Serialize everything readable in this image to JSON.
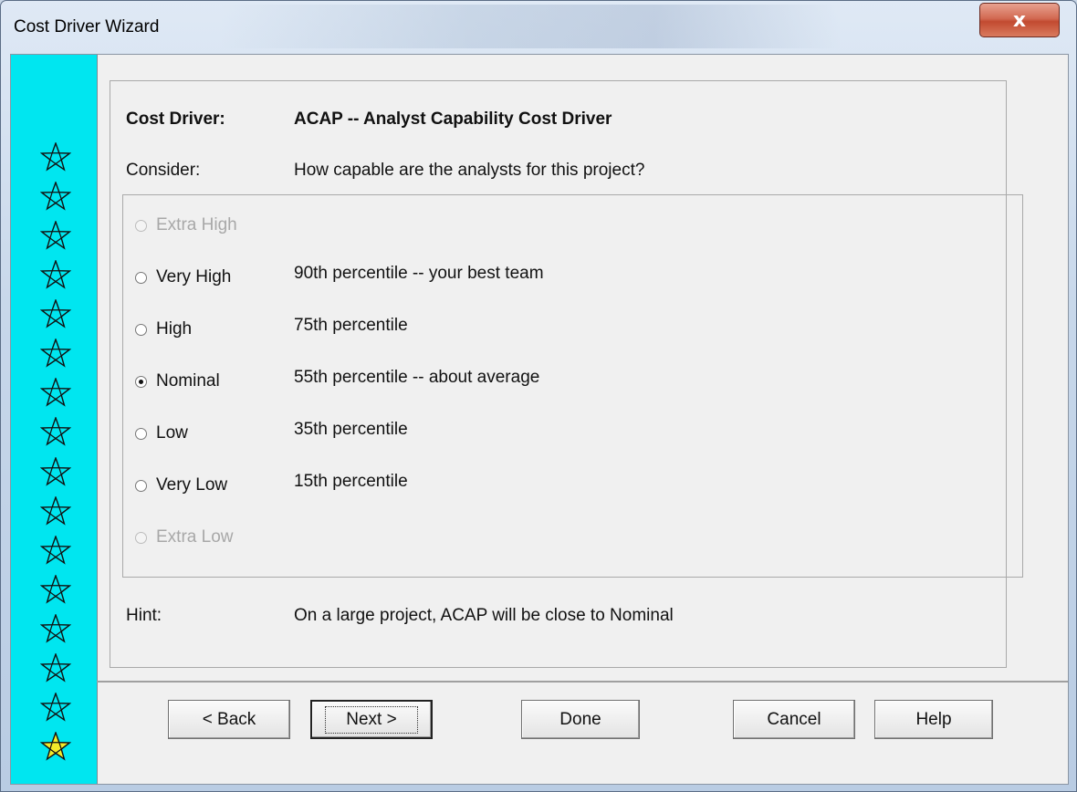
{
  "window": {
    "title": "Cost Driver Wizard",
    "close_glyph": "x"
  },
  "star_strip": {
    "stars": [
      {
        "state": "done"
      },
      {
        "state": "done"
      },
      {
        "state": "done"
      },
      {
        "state": "done"
      },
      {
        "state": "done"
      },
      {
        "state": "done"
      },
      {
        "state": "done"
      },
      {
        "state": "done"
      },
      {
        "state": "done"
      },
      {
        "state": "done"
      },
      {
        "state": "done"
      },
      {
        "state": "done"
      },
      {
        "state": "done"
      },
      {
        "state": "done"
      },
      {
        "state": "done"
      },
      {
        "state": "current"
      }
    ]
  },
  "header": {
    "driver_label": "Cost Driver:",
    "driver_value": "ACAP -- Analyst Capability Cost Driver",
    "consider_label": "Consider:",
    "consider_value": "How capable are the analysts for this project?"
  },
  "options": [
    {
      "label": "Extra High",
      "description": "",
      "enabled": false,
      "selected": false
    },
    {
      "label": "Very High",
      "description": "90th percentile -- your best team",
      "enabled": true,
      "selected": false
    },
    {
      "label": "High",
      "description": "75th percentile",
      "enabled": true,
      "selected": false
    },
    {
      "label": "Nominal",
      "description": "55th percentile -- about average",
      "enabled": true,
      "selected": true
    },
    {
      "label": "Low",
      "description": "35th percentile",
      "enabled": true,
      "selected": false
    },
    {
      "label": "Very Low",
      "description": "15th percentile",
      "enabled": true,
      "selected": false
    },
    {
      "label": "Extra Low",
      "description": "",
      "enabled": false,
      "selected": false
    }
  ],
  "hint": {
    "label": "Hint:",
    "value": "On a large project, ACAP will be close to Nominal"
  },
  "buttons": {
    "back": "< Back",
    "next": "Next >",
    "done": "Done",
    "cancel": "Cancel",
    "help": "Help"
  },
  "colors": {
    "star_strip_bg": "#00e6f0",
    "current_star_fill": "#f2ea2a"
  }
}
